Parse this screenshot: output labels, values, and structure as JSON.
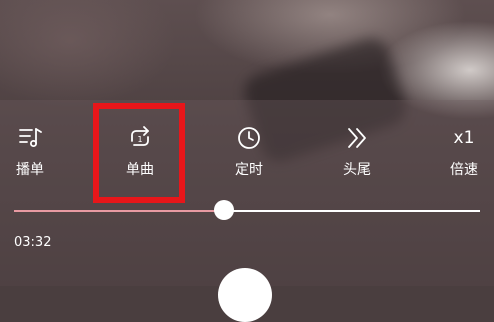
{
  "controls": {
    "playlist": {
      "label": "播单",
      "icon": "playlist-icon"
    },
    "single": {
      "label": "单曲",
      "icon": "repeat-one-icon"
    },
    "timer": {
      "label": "定时",
      "icon": "clock-icon"
    },
    "head_tail": {
      "label": "头尾",
      "icon": "double-chevron-right-icon"
    },
    "speed": {
      "label": "倍速",
      "value": "x1"
    }
  },
  "progress": {
    "current_time": "03:32",
    "fraction": 0.45
  },
  "colors": {
    "highlight": "#e8161a",
    "progress_played": "#e89aa2",
    "progress_track": "#ffffff"
  }
}
